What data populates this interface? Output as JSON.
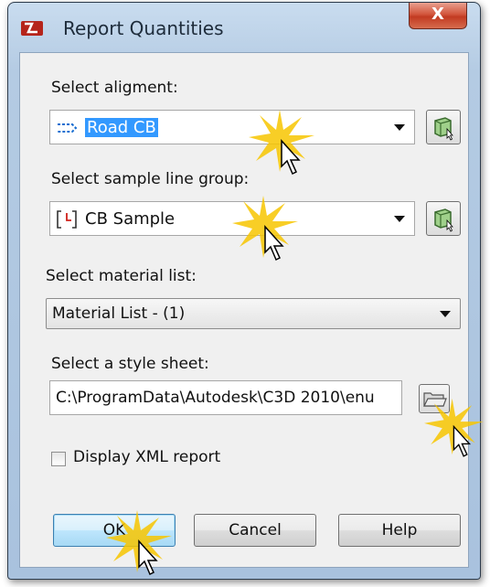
{
  "window": {
    "title": "Report Quantities",
    "close_label": "X"
  },
  "alignment": {
    "label": "Select aligment:",
    "value": "Road CB"
  },
  "sample_line_group": {
    "label": "Select sample line group:",
    "value": "CB Sample"
  },
  "material_list": {
    "label": "Select material list:",
    "value": "Material List - (1)"
  },
  "style_sheet": {
    "label": "Select a style sheet:",
    "value": "C:\\ProgramData\\Autodesk\\C3D 2010\\enu"
  },
  "display_xml": {
    "label": "Display XML report",
    "checked": false
  },
  "buttons": {
    "ok": "OK",
    "cancel": "Cancel",
    "help": "Help"
  },
  "icons": {
    "app": "civil3d-app-icon",
    "alignment": "alignment-icon",
    "sample_line": "sample-line-group-icon",
    "pick": "pick-from-drawing-icon",
    "folder": "folder-open-icon",
    "cursor": "click-cursor-icon"
  },
  "colors": {
    "selection": "#3399ff",
    "close": "#c23b22",
    "highlight": "#f7c600"
  }
}
